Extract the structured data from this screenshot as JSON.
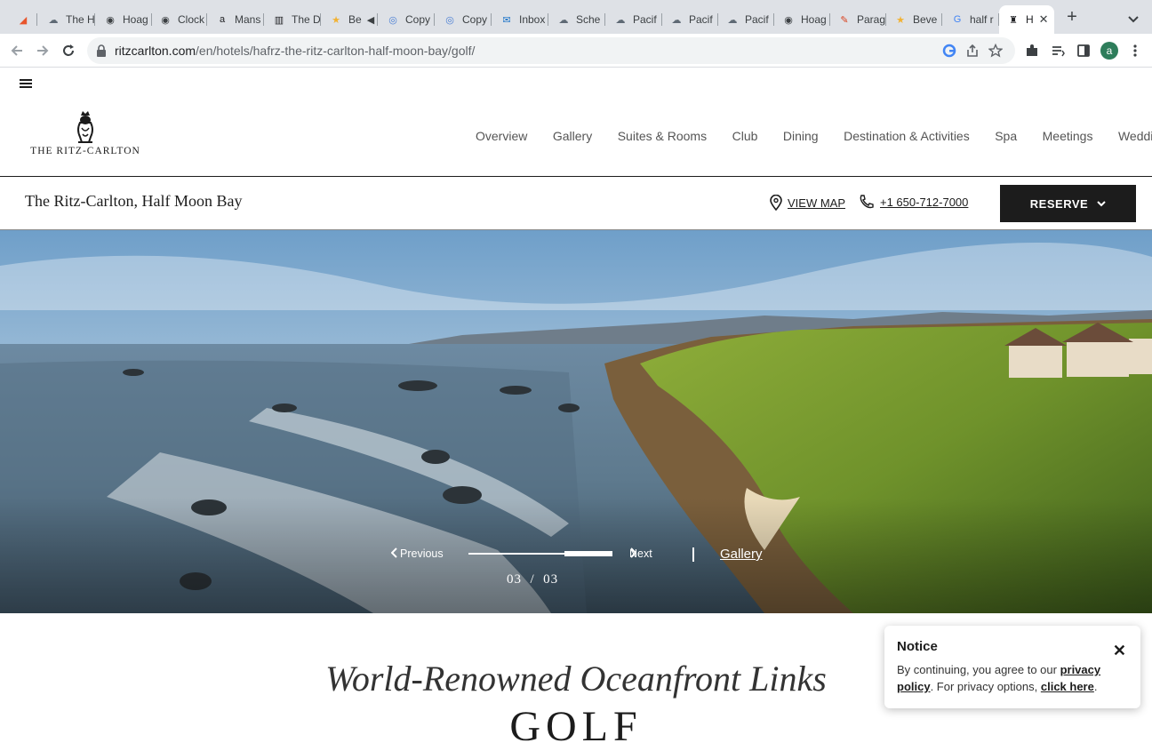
{
  "browser": {
    "tabs": [
      {
        "title": "",
        "icon": "figma-icon"
      },
      {
        "title": "The H",
        "icon": "cloud-icon"
      },
      {
        "title": "Hoag",
        "icon": "globe-icon"
      },
      {
        "title": "Clock",
        "icon": "globe-icon"
      },
      {
        "title": "Mans",
        "icon": "amazon-icon"
      },
      {
        "title": "The D",
        "icon": "book-icon"
      },
      {
        "title": "Be",
        "icon": "star-icon"
      },
      {
        "title": "Copy",
        "icon": "chatgpt-icon"
      },
      {
        "title": "Copy",
        "icon": "chatgpt-icon"
      },
      {
        "title": "Inbox",
        "icon": "outlook-icon"
      },
      {
        "title": "Sche",
        "icon": "cloud-icon"
      },
      {
        "title": "Pacif",
        "icon": "cloud-icon"
      },
      {
        "title": "Pacif",
        "icon": "cloud-icon"
      },
      {
        "title": "Pacif",
        "icon": "cloud-icon"
      },
      {
        "title": "Hoag",
        "icon": "globe-icon"
      },
      {
        "title": "Parag",
        "icon": "pen-icon"
      },
      {
        "title": "Beve",
        "icon": "star-icon"
      },
      {
        "title": "half r",
        "icon": "google-icon"
      },
      {
        "title": "H",
        "icon": "ritz-lion-icon"
      }
    ],
    "url_host": "ritzcarlton.com",
    "url_path": "/en/hotels/hafrz-the-ritz-carlton-half-moon-bay/golf/",
    "profile_initial": "a"
  },
  "site": {
    "logo_text": "THE RITZ-CARLTON",
    "nav": [
      "Overview",
      "Gallery",
      "Suites & Rooms",
      "Club",
      "Dining",
      "Destination & Activities",
      "Spa",
      "Meetings",
      "Weddings"
    ],
    "hotel_name": "The Ritz-Carlton, Half Moon Bay",
    "view_map": "VIEW MAP",
    "phone": "+1 650-712-7000",
    "reserve": "RESERVE"
  },
  "carousel": {
    "previous": "Previous",
    "next": "Next",
    "gallery": "Gallery",
    "counter": "03  /  03",
    "progress": 1.0
  },
  "content": {
    "headline": "World-Renowned Oceanfront Links",
    "subhead": "GOLF"
  },
  "notice": {
    "title": "Notice",
    "body_prefix": "By continuing, you agree to our ",
    "privacy_link": "privacy policy",
    "body_mid": ". For privacy options, ",
    "options_link": "click here",
    "body_suffix": "."
  }
}
